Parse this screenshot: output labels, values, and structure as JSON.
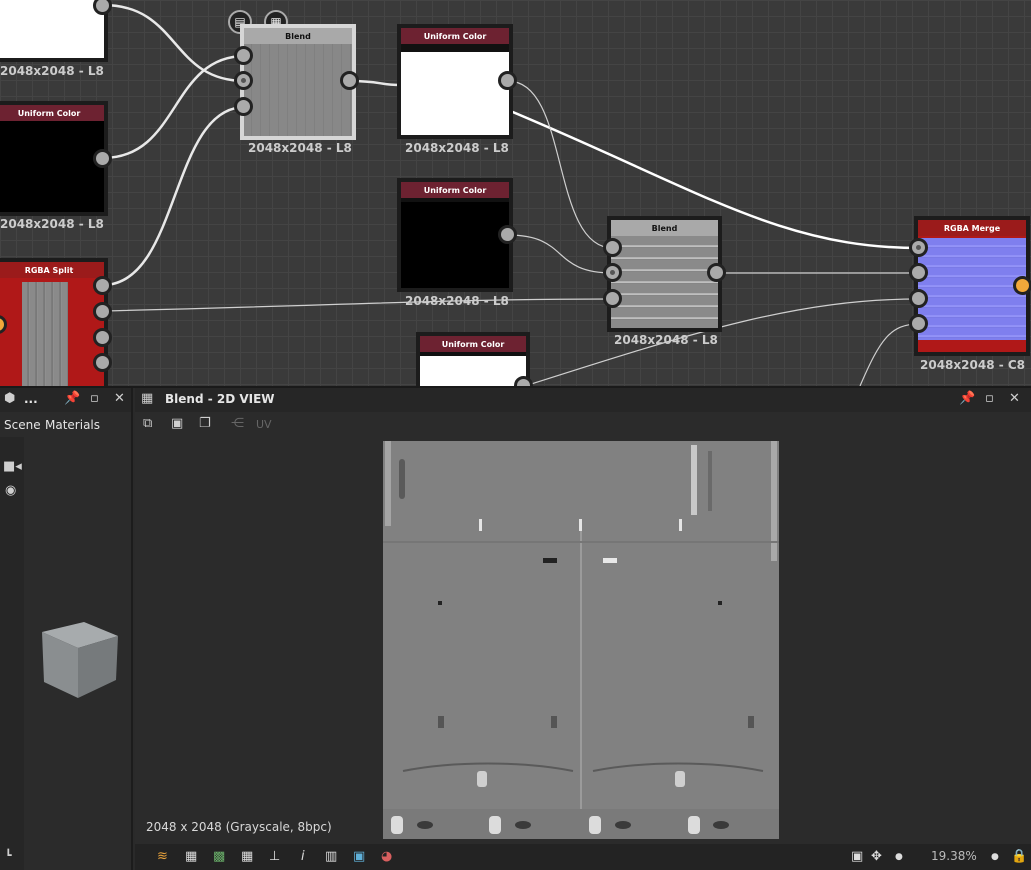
{
  "graph": {
    "nodes": {
      "top_left": {
        "caption": "2048x2048 - L8"
      },
      "uniform_left": {
        "title": "Uniform Color",
        "caption": "2048x2048 - L8"
      },
      "rgba_split": {
        "title": "RGBA Split"
      },
      "blend_top": {
        "title": "Blend",
        "caption": "2048x2048 - L8"
      },
      "uniform_white": {
        "title": "Uniform Color",
        "caption": "2048x2048 - L8"
      },
      "uniform_black": {
        "title": "Uniform Color",
        "caption": "2048x2048 - L8"
      },
      "uniform_bottom": {
        "title": "Uniform Color"
      },
      "blend_mid": {
        "title": "Blend",
        "caption": "2048x2048 - L8"
      },
      "rgba_merge": {
        "title": "RGBA Merge",
        "caption": "2048x2048 - C8"
      }
    },
    "colors": {
      "header_uniform": "#6d2231",
      "header_split": "#9b1b1b",
      "header_blend": "#a9a9a9",
      "port_orange": "#f2a83a"
    },
    "node_icons": [
      "document-icon",
      "checker-icon"
    ]
  },
  "left_panel": {
    "title": "...",
    "tabs": [
      "Scene",
      "Materials"
    ],
    "icons": [
      "cube-icon",
      "pin-icon",
      "maximize-icon",
      "close-icon",
      "camera-icon",
      "light-icon"
    ]
  },
  "view_panel": {
    "title": "Blend - 2D VIEW",
    "toolbar_icons": [
      "export-icon",
      "save-icon",
      "copy-icon",
      "share-icon"
    ],
    "uv_label": "UV",
    "image_info": "2048 x 2048 (Grayscale, 8bpc)"
  },
  "status_bar": {
    "icons": [
      "layers-icon",
      "checker-icon",
      "color-channels-icon",
      "grid-icon",
      "transform-icon",
      "info-icon",
      "histogram-icon",
      "display-icon",
      "color-wheel-icon",
      "fit-icon",
      "pan-icon",
      "zoom-icon",
      "lock-icon"
    ],
    "zoom": "19.38%"
  }
}
